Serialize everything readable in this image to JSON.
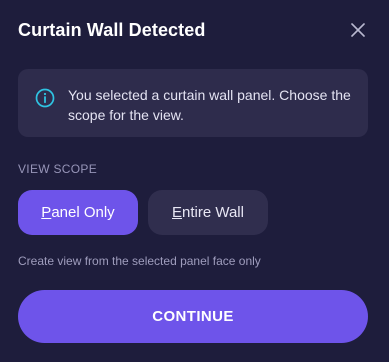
{
  "dialog": {
    "title": "Curtain Wall Detected",
    "close_icon": "close-icon"
  },
  "info": {
    "icon": "info-icon",
    "text": "You selected a curtain wall panel. Choose the scope for the view."
  },
  "scope": {
    "label": "VIEW SCOPE",
    "options": [
      {
        "first": "P",
        "rest": "anel Only",
        "selected": true
      },
      {
        "first": "E",
        "rest": "ntire Wall",
        "selected": false
      }
    ],
    "hint": "Create view from the selected panel face only"
  },
  "actions": {
    "continue_label": "CONTINUE"
  },
  "colors": {
    "background": "#1e1d3c",
    "accent": "#6e54ea",
    "info_icon": "#2fc4e2"
  }
}
